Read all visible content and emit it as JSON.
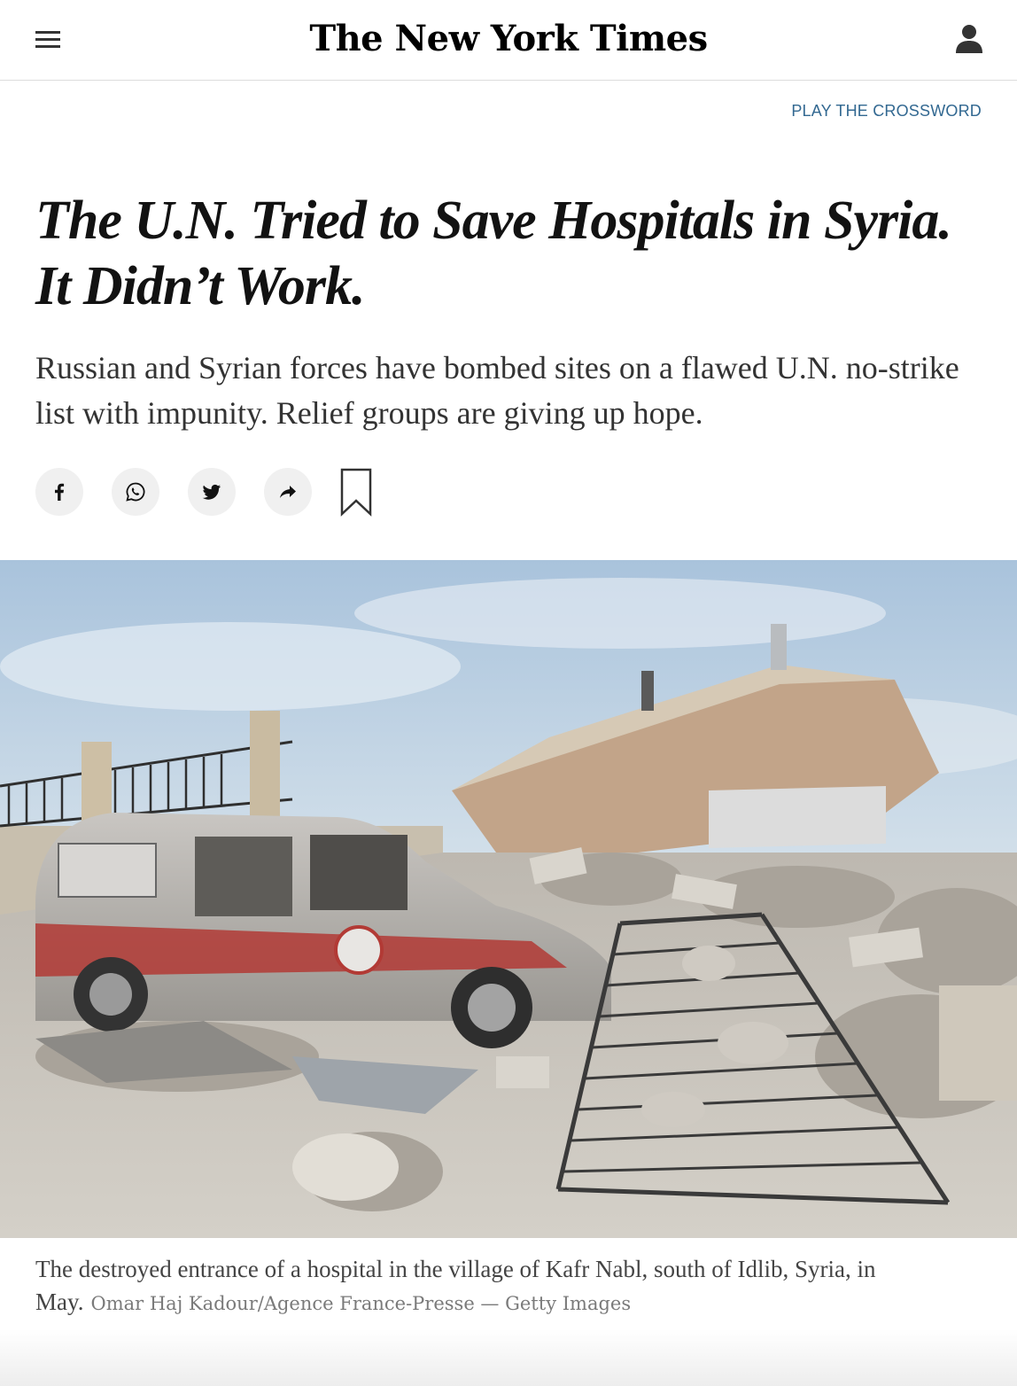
{
  "header": {
    "logo_text": "The New York Times",
    "menu_icon": "hamburger-menu-icon",
    "account_icon": "user-account-icon"
  },
  "promo": {
    "crossword_link": "PLAY THE CROSSWORD"
  },
  "article": {
    "headline": "The U.N. Tried to Save Hospitals in Syria. It Didn’t Work.",
    "summary": "Russian and Syrian forces have bombed sites on a flawed U.N. no-strike list with impunity. Relief groups are giving up hope."
  },
  "share": {
    "icons": [
      "facebook-icon",
      "whatsapp-icon",
      "twitter-icon",
      "share-arrow-icon",
      "bookmark-icon"
    ]
  },
  "image": {
    "caption": "The destroyed entrance of a hospital in the village of Kafr Nabl, south of Idlib, Syria, in May.",
    "credit": "Omar Haj Kadour/Agence France-Presse — Getty Images"
  },
  "colors": {
    "link": "#326891",
    "text": "#121212",
    "share_button_bg": "#f0f0f0"
  }
}
